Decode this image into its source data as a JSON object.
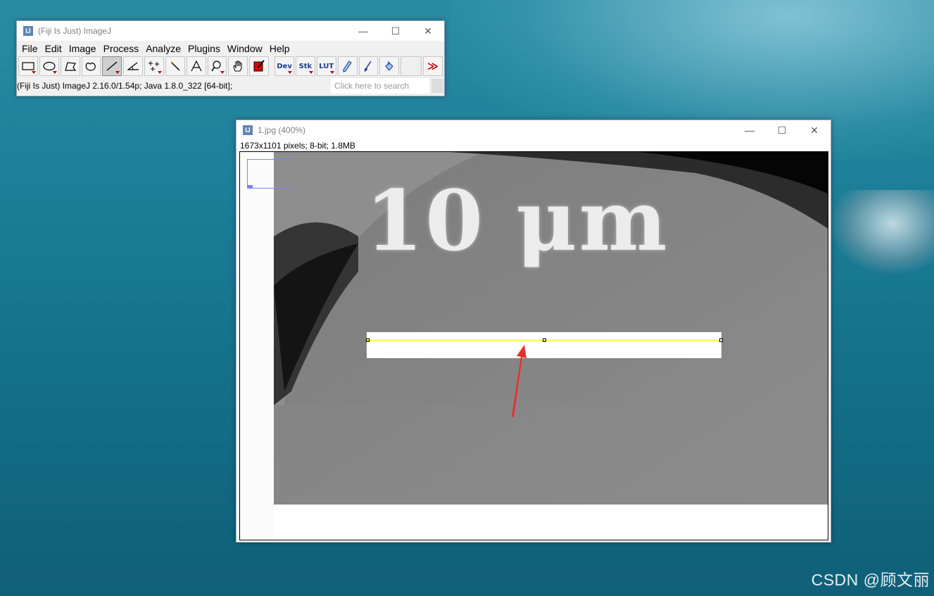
{
  "desktop": {
    "watermark": "CSDN @顾文丽"
  },
  "imagej": {
    "title": "(Fiji Is Just) ImageJ",
    "app_icon_text": "IJ",
    "menu": [
      "File",
      "Edit",
      "Image",
      "Process",
      "Analyze",
      "Plugins",
      "Window",
      "Help"
    ],
    "tools": {
      "dev_label": "Dev",
      "stk_label": "Stk",
      "lut_label": "LUT",
      "more_label": "≫"
    },
    "status": "(Fiji Is Just) ImageJ 2.16.0/1.54p; Java 1.8.0_322 [64-bit];",
    "search_placeholder": "Click here to search",
    "window_controls": {
      "minimize": "—",
      "maximize": "☐",
      "close": "✕"
    }
  },
  "image_window": {
    "title": "1.jpg (400%)",
    "info": "1673x1101 pixels; 8-bit; 1.8MB",
    "image_text": "10 μm",
    "window_controls": {
      "minimize": "—",
      "maximize": "☐",
      "close": "✕"
    }
  },
  "colors": {
    "roi_line": "#e8e800",
    "annotation_arrow": "#e8302a",
    "navigator": "#8080ff"
  }
}
